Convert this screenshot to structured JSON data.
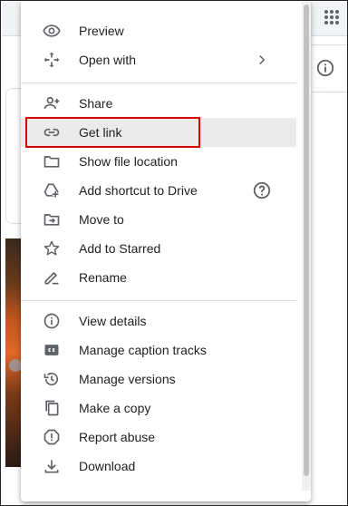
{
  "menu": {
    "items": [
      {
        "label": "Preview",
        "icon": "eye-icon"
      },
      {
        "label": "Open with",
        "icon": "open-with-icon",
        "has_submenu": true
      },
      {
        "label": "Share",
        "icon": "person-add-icon"
      },
      {
        "label": "Get link",
        "icon": "link-icon",
        "highlighted": true
      },
      {
        "label": "Show file location",
        "icon": "folder-icon"
      },
      {
        "label": "Add shortcut to Drive",
        "icon": "add-to-drive-icon",
        "help": true
      },
      {
        "label": "Move to",
        "icon": "move-to-folder-icon"
      },
      {
        "label": "Add to Starred",
        "icon": "star-icon"
      },
      {
        "label": "Rename",
        "icon": "pencil-icon"
      },
      {
        "label": "View details",
        "icon": "info-icon"
      },
      {
        "label": "Manage caption tracks",
        "icon": "closed-caption-icon"
      },
      {
        "label": "Manage versions",
        "icon": "history-icon"
      },
      {
        "label": "Make a copy",
        "icon": "copy-icon"
      },
      {
        "label": "Report abuse",
        "icon": "report-icon"
      },
      {
        "label": "Download",
        "icon": "download-icon"
      }
    ]
  },
  "colors": {
    "highlight_border": "#e00000",
    "icon": "#5f6368",
    "text": "#202124",
    "active_row": "#ebebeb"
  }
}
